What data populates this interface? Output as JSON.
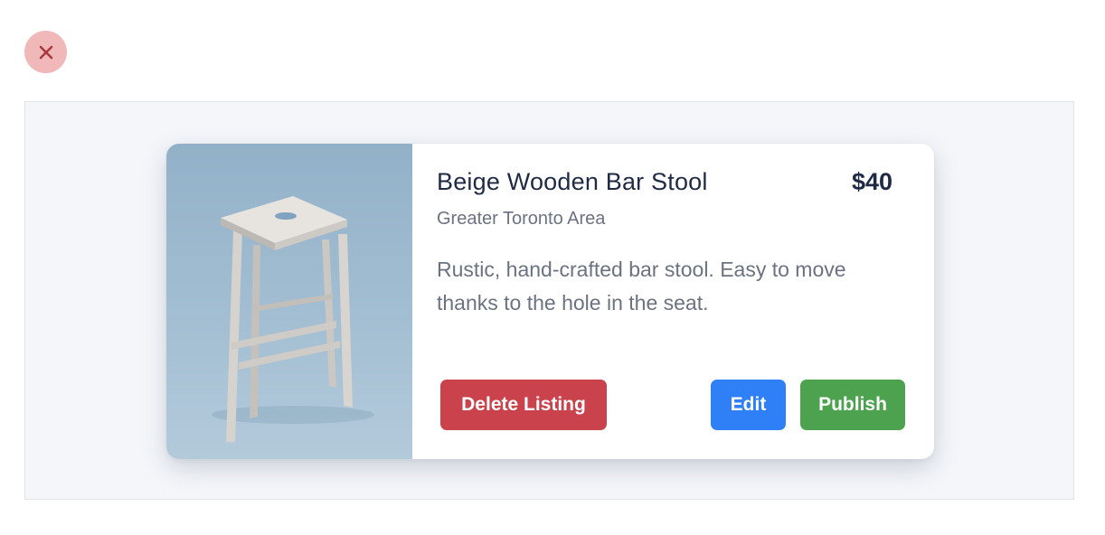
{
  "close": {
    "icon": "close-icon",
    "color": "#a83a3f"
  },
  "listing": {
    "title": "Beige Wooden Bar Stool",
    "price": "$40",
    "location": "Greater Toronto Area",
    "description": "Rustic, hand-crafted bar stool. Easy to move thanks to the hole in the seat.",
    "image": {
      "alt": "Beige wooden bar stool on blue background"
    }
  },
  "actions": {
    "delete_label": "Delete Listing",
    "edit_label": "Edit",
    "publish_label": "Publish"
  },
  "colors": {
    "delete": "#c9424c",
    "edit": "#2f80f7",
    "publish": "#4ca24f",
    "title": "#1f2a44",
    "muted": "#6b7280"
  }
}
